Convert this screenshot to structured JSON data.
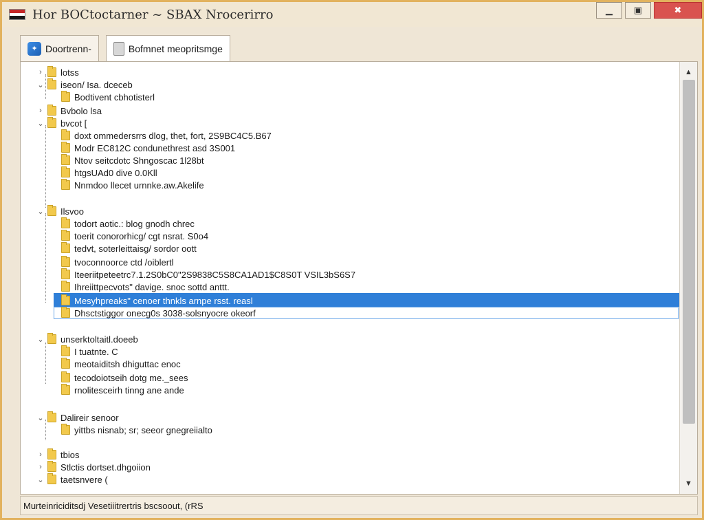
{
  "window": {
    "title": "Hor BOCtoctarner ~ SBAX Nrocerirro",
    "buttons": {
      "minimize": "▁",
      "restore": "▣",
      "close": "✖"
    }
  },
  "tabs": [
    {
      "label": "Doortrenn-",
      "icon": "app-icon"
    },
    {
      "label": "Bofmnet meopritsmge",
      "icon": "document-icon"
    }
  ],
  "tree": {
    "rows": [
      {
        "label": "lotss",
        "level": 0,
        "expanded": false
      },
      {
        "label": "iseon/ Isa. dceceb",
        "level": 0,
        "expanded": true
      },
      {
        "label": "Bodtivent cbhotisterl",
        "level": 1
      },
      {
        "label": "Bvbolo lsa",
        "level": 0,
        "expanded": false
      },
      {
        "label": "bvcot [",
        "level": 0,
        "expanded": true
      },
      {
        "label": "doxt ommedersrrs dlog, thet, fort, 2S9BC4C5.B67",
        "level": 1
      },
      {
        "label": "Modr EC812C condunethrest asd 3S001",
        "level": 1
      },
      {
        "label": "Ntov seitcdotc Shngoscac 1l28bt",
        "level": 1
      },
      {
        "label": "htgsUAd0 dive 0.0Kll",
        "level": 1
      },
      {
        "label": "Nnmdoo llecet urnnke.aw.Akelife",
        "level": 1
      },
      {
        "label": "Ilsvoo",
        "level": 0,
        "expanded": true
      },
      {
        "label": "todort aotic.: blog gnodh chrec",
        "level": 1
      },
      {
        "label": "toerit conororhicg/ cgt nsrat. S0o4",
        "level": 1
      },
      {
        "label": "tedvt, soterleittaisg/ sordor oott",
        "level": 1
      },
      {
        "label": "tvoconnoorce ctd /oiblertl",
        "level": 1
      },
      {
        "label": "Iteeriitpeteetrc7.1.2S0bC0\"2S9838C5S8CA1AD1$C8S0T VSIL3bS6S7",
        "level": 1
      },
      {
        "label": "Ihreiittpecvots\" davige. snoc sottd anttt.",
        "level": 1
      },
      {
        "label": "Mesyhpreaks\" cenoer thnkls arnpe rsst. reasl",
        "level": 1,
        "selected": true
      },
      {
        "label": "Dhsctstiggor onecg0s 3038-solsnyocre okeorf",
        "level": 1
      },
      {
        "label": "unserktoltaitl.doeeb",
        "level": 0,
        "expanded": true
      },
      {
        "label": "I tuatnte. C",
        "level": 1
      },
      {
        "label": "meotaiditsh dhiguttac enoc",
        "level": 1
      },
      {
        "label": "tecodoiotseih dotg me._sees",
        "level": 1
      },
      {
        "label": "rnolitesceirh tinng ane ande",
        "level": 1
      },
      {
        "label": "Dalireir senoor",
        "level": 0,
        "expanded": true
      },
      {
        "label": "yittbs nisnab; sr; seeor gnegreiialto",
        "level": 1
      },
      {
        "label": "tbios",
        "level": 0,
        "expanded": false
      },
      {
        "label": "Stlctis dortset.dhgoiion",
        "level": 0,
        "expanded": false
      },
      {
        "label": "taetsnvere (",
        "level": 0,
        "expanded": true
      }
    ]
  },
  "status": {
    "text": "Murteinriciditsdj Vesetiiitrertris bscsoout, (rRS"
  }
}
